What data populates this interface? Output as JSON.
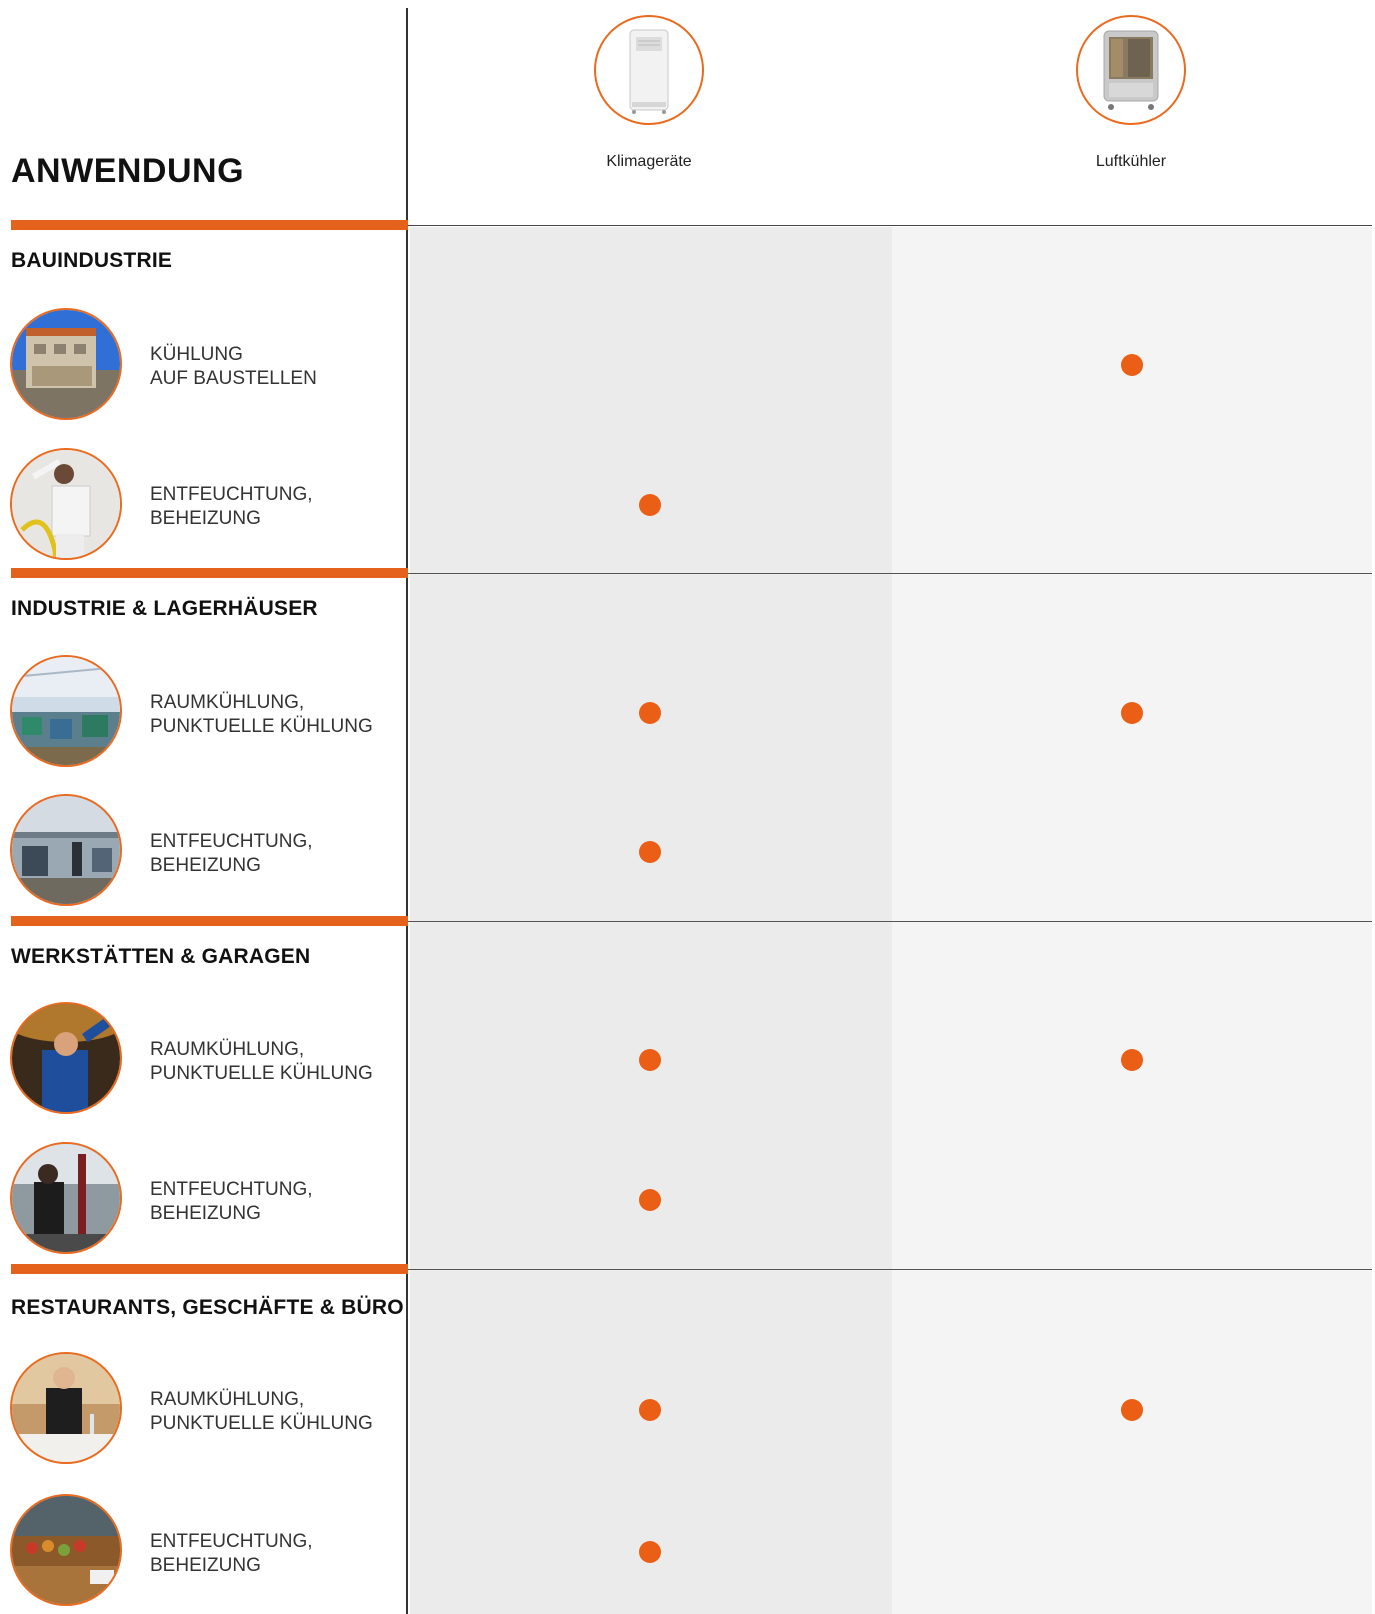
{
  "header": {
    "title": "ANWENDUNG",
    "products": [
      {
        "label": "Klimageräte",
        "icon": "portable-air-conditioner"
      },
      {
        "label": "Luftkühler",
        "icon": "evaporative-air-cooler"
      }
    ]
  },
  "sections": [
    {
      "title": "BAUINDUSTRIE",
      "rows": [
        {
          "line1": "KÜHLUNG",
          "line2": "AUF BAUSTELLEN",
          "klima": false,
          "luft": true
        },
        {
          "line1": "ENTFEUCHTUNG,",
          "line2": "BEHEIZUNG",
          "klima": true,
          "luft": false
        }
      ]
    },
    {
      "title": "INDUSTRIE & LAGERHÄUSER",
      "rows": [
        {
          "line1": "RAUMKÜHLUNG,",
          "line2": "PUNKTUELLE KÜHLUNG",
          "klima": true,
          "luft": true
        },
        {
          "line1": "ENTFEUCHTUNG,",
          "line2": "BEHEIZUNG",
          "klima": true,
          "luft": false
        }
      ]
    },
    {
      "title": "WERKSTÄTTEN & GARAGEN",
      "rows": [
        {
          "line1": "RAUMKÜHLUNG,",
          "line2": "PUNKTUELLE KÜHLUNG",
          "klima": true,
          "luft": true
        },
        {
          "line1": "ENTFEUCHTUNG,",
          "line2": "BEHEIZUNG",
          "klima": true,
          "luft": false
        }
      ]
    },
    {
      "title": "RESTAURANTS, GESCHÄFTE & BÜRO",
      "rows": [
        {
          "line1": "RAUMKÜHLUNG,",
          "line2": "PUNKTUELLE KÜHLUNG",
          "klima": true,
          "luft": true
        },
        {
          "line1": "ENTFEUCHTUNG,",
          "line2": "BEHEIZUNG",
          "klima": true,
          "luft": false
        }
      ]
    }
  ],
  "colors": {
    "accent": "#e4621c",
    "dot": "#ea5f15",
    "col1_bg": "#ebebeb",
    "col2_bg": "#f4f4f4"
  }
}
